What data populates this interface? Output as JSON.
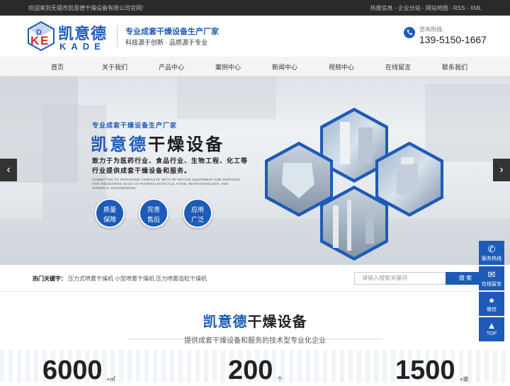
{
  "topbar": {
    "welcome": "欢迎来到无锡市凯意德干燥设备有限公司官网!",
    "links": [
      "热推信息",
      "企业分站",
      "网站地图",
      "RSS",
      "XML"
    ],
    "separator": " - "
  },
  "header": {
    "logo_cn": "凯意德",
    "logo_en": "KADE",
    "slogan_main": "专业成套干燥设备生产厂家",
    "slogan_sub": "科技源于创新 · 品质源于专业",
    "phone_label": "咨询热线:",
    "phone_number": "139-5150-1667",
    "brand_color": "#1e5bb8"
  },
  "nav": {
    "items": [
      "首页",
      "关于我们",
      "产品中心",
      "案例中心",
      "新闻中心",
      "视频中心",
      "在线留言",
      "联系我们"
    ]
  },
  "banner": {
    "pretitle": "专业成套干燥设备生产厂家",
    "title_blue": "凯意德",
    "title_rest": "干燥设备",
    "desc_line1": "致力于为医药行业、食品行业、生物工程、化工等",
    "desc_line2": "行业提供成套干燥设备和服务。",
    "desc_en": "COMMITTED TO PROVIDING COMPLETE SETS OF DRYING EQUIPMENT AND SERVICES FOR INDUSTRIES SUCH AS PHARMACEUTICALS, FOOD, BIOTECHNOLOGY, AND CHEMICAL ENGINEERING.",
    "badges": [
      {
        "line1": "质量",
        "line2": "保障"
      },
      {
        "line1": "完善",
        "line2": "售后"
      },
      {
        "line1": "应用",
        "line2": "广泛"
      }
    ],
    "prev_arrow": "‹",
    "next_arrow": "›"
  },
  "keywords": {
    "label": "热门关键字：",
    "items": [
      "压力式喷雾干燥机",
      "小型喷雾干燥机",
      "压力喷雾造粒干燥机"
    ],
    "search_placeholder": "请输入搜索关键词",
    "search_button": "搜 索"
  },
  "intro": {
    "title_blue": "凯意德",
    "title_rest": "干燥设备",
    "subtitle": "提供成套干燥设备和服务的技术型专业化企业"
  },
  "stats": [
    {
      "value": "6000",
      "unit": "+㎡"
    },
    {
      "value": "200",
      "unit": "个"
    },
    {
      "value": "1500",
      "unit": "+家"
    }
  ],
  "sidebar": [
    {
      "label": "服务热线",
      "icon": "phone-icon"
    },
    {
      "label": "在线留言",
      "icon": "chat-icon"
    },
    {
      "label": "微信",
      "icon": "wechat-icon"
    },
    {
      "label": "TOP",
      "icon": "arrow-up-icon"
    }
  ]
}
